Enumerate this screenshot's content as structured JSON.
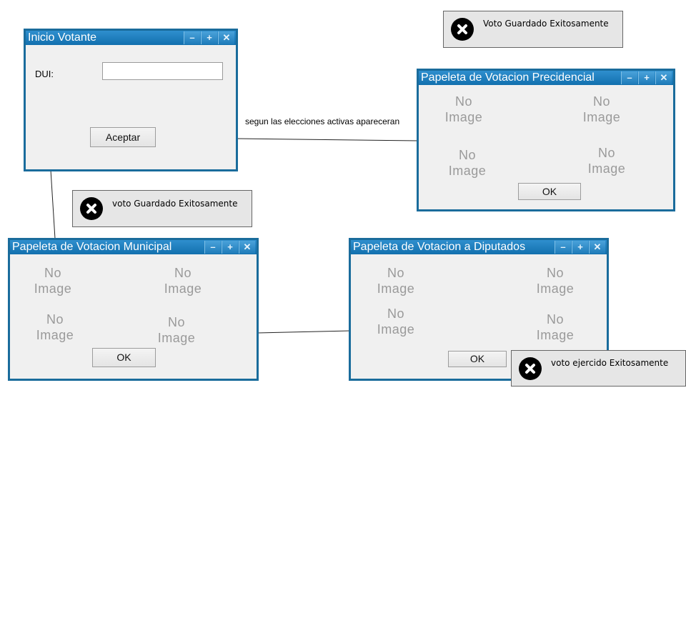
{
  "window_controls": {
    "minimize": "–",
    "maximize": "+",
    "close": "✕"
  },
  "no_image": {
    "line1": "No",
    "line2": "Image"
  },
  "inicio": {
    "title": "Inicio Votante",
    "dui_label": "DUI:",
    "dui_value": "",
    "accept_label": "Aceptar"
  },
  "presidencial": {
    "title": "Papeleta de Votacion Precidencial",
    "ok_label": "OK"
  },
  "municipal": {
    "title": "Papeleta de Votacion Municipal",
    "ok_label": "OK"
  },
  "diputados": {
    "title": "Papeleta de Votacion a Diputados",
    "ok_label": "OK"
  },
  "toasts": {
    "top": {
      "message": "Voto Guardado Exitosamente",
      "icon": "close-circle-icon"
    },
    "middle": {
      "message": "voto Guardado Exitosamente",
      "icon": "close-circle-icon"
    },
    "bottom": {
      "message": "voto ejercido Exitosamente",
      "icon": "close-circle-icon"
    }
  },
  "annotation": "segun las elecciones activas apareceran",
  "colors": {
    "window_border": "#1a6c9c",
    "titlebar": "#1e7fbf",
    "window_bg": "#f0f0f0",
    "toast_bg": "#e6e6e6"
  }
}
